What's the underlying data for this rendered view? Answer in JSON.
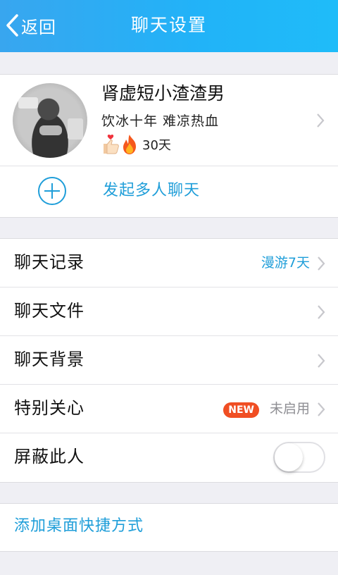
{
  "header": {
    "back_label": "返回",
    "title": "聊天设置"
  },
  "profile": {
    "nickname": "肾虚短小渣渣男",
    "signature": "饮冰十年 难凉热血",
    "days": "30天",
    "badge_icons": [
      "thumbs-up-heart-icon",
      "fire-icon"
    ]
  },
  "group_chat": {
    "label": "发起多人聊天"
  },
  "settings": {
    "items": [
      {
        "label": "聊天记录",
        "value": "漫游7天"
      },
      {
        "label": "聊天文件"
      },
      {
        "label": "聊天背景"
      },
      {
        "label": "特别关心",
        "badge": "NEW",
        "value": "未启用"
      },
      {
        "label": "屏蔽此人",
        "toggle": false
      }
    ]
  },
  "shortcut": {
    "label": "添加桌面快捷方式"
  },
  "colors": {
    "header_start": "#38a6ef",
    "header_end": "#1fbcf9",
    "accent": "#1f9ed9",
    "new_badge": "#f04e23",
    "background": "#efeff4"
  }
}
